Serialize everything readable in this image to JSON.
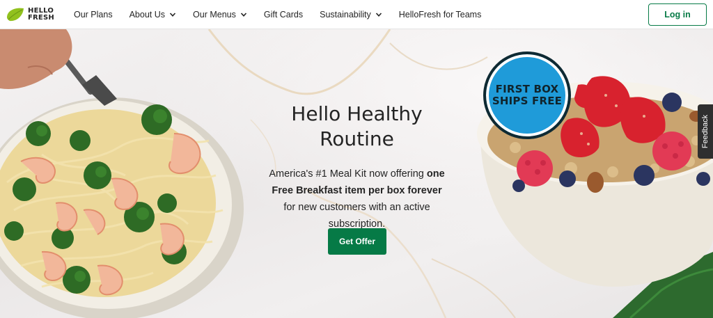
{
  "header": {
    "logo": {
      "line1": "HELLO",
      "line2": "FRESH",
      "icon": "lime-leaf-logo"
    },
    "nav": [
      {
        "label": "Our Plans",
        "has_dropdown": false
      },
      {
        "label": "About Us",
        "has_dropdown": true
      },
      {
        "label": "Our Menus",
        "has_dropdown": true
      },
      {
        "label": "Gift Cards",
        "has_dropdown": false
      },
      {
        "label": "Sustainability",
        "has_dropdown": true
      },
      {
        "label": "HelloFresh for Teams",
        "has_dropdown": false
      }
    ],
    "login_label": "Log in"
  },
  "hero": {
    "title_line1": "Hello Healthy",
    "title_line2": "Routine",
    "body_prefix": "America's #1 Meal Kit now offering",
    "body_bold": "one Free Breakfast item per box forever",
    "body_suffix": "for new customers with an active subscription.",
    "cta_label": "Get Offer",
    "badge_line1": "FIRST BOX",
    "badge_line2": "SHIPS FREE",
    "left_image": "shrimp-broccoli-pasta-bowl",
    "right_image": "oatmeal-berries-bowl"
  },
  "feedback_label": "Feedback",
  "colors": {
    "brand_green": "#067a46",
    "badge_blue": "#1f9bd9",
    "logo_lime": "#91c11e",
    "text": "#242424"
  }
}
